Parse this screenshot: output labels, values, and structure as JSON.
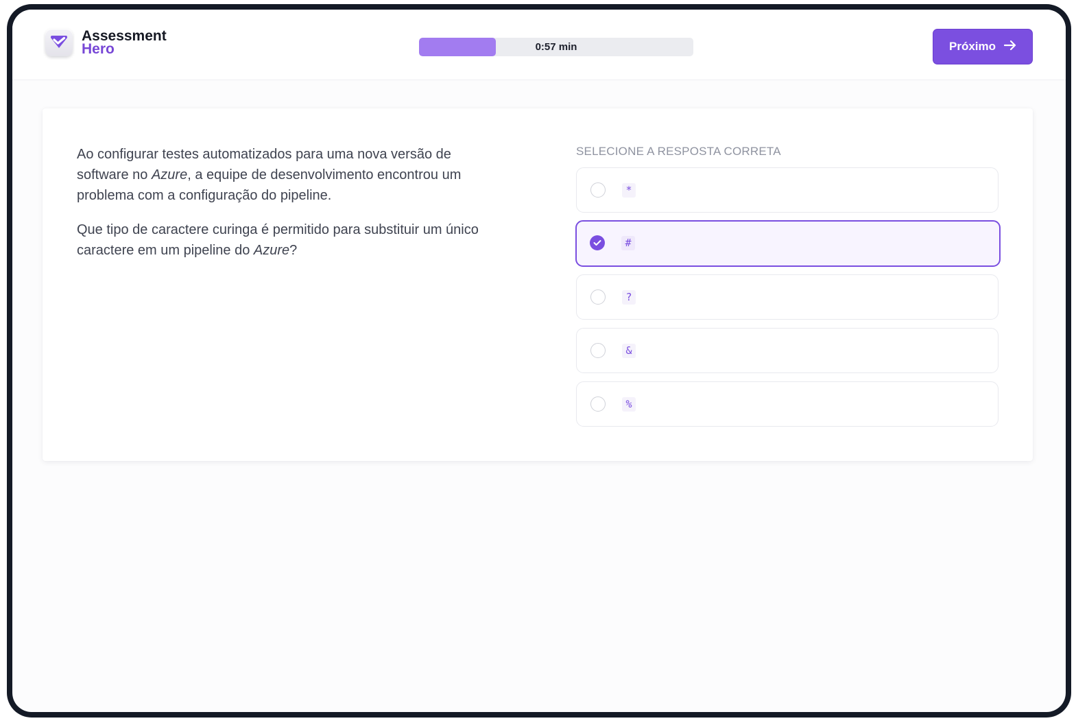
{
  "app": {
    "logo_line1": "Assessment",
    "logo_line2": "Hero",
    "logo_icon": "heart-check-icon"
  },
  "header": {
    "timer_text": "0:57 min",
    "timer_progress": 0.28,
    "next_label": "Próximo",
    "next_icon": "arrow-right-icon"
  },
  "question": {
    "p1_a": "Ao configurar testes automatizados para uma nova versão de software no ",
    "p1_em": "Azure",
    "p1_b": ", a equipe de desenvolvimento encontrou um problema com a configuração do pipeline.",
    "p2_a": "Que tipo de caractere curinga é permitido para substituir um único caractere em um pipeline do ",
    "p2_em": "Azure",
    "p2_b": "?"
  },
  "answers": {
    "title": "SELECIONE A RESPOSTA CORRETA",
    "options": [
      {
        "label": "*",
        "selected": false
      },
      {
        "label": "#",
        "selected": true
      },
      {
        "label": "?",
        "selected": false
      },
      {
        "label": "&",
        "selected": false
      },
      {
        "label": "%",
        "selected": false
      }
    ]
  },
  "colors": {
    "accent": "#7b4fe0",
    "timer_fill": "#a27cf0",
    "selected_bg": "#f8f4ff"
  }
}
